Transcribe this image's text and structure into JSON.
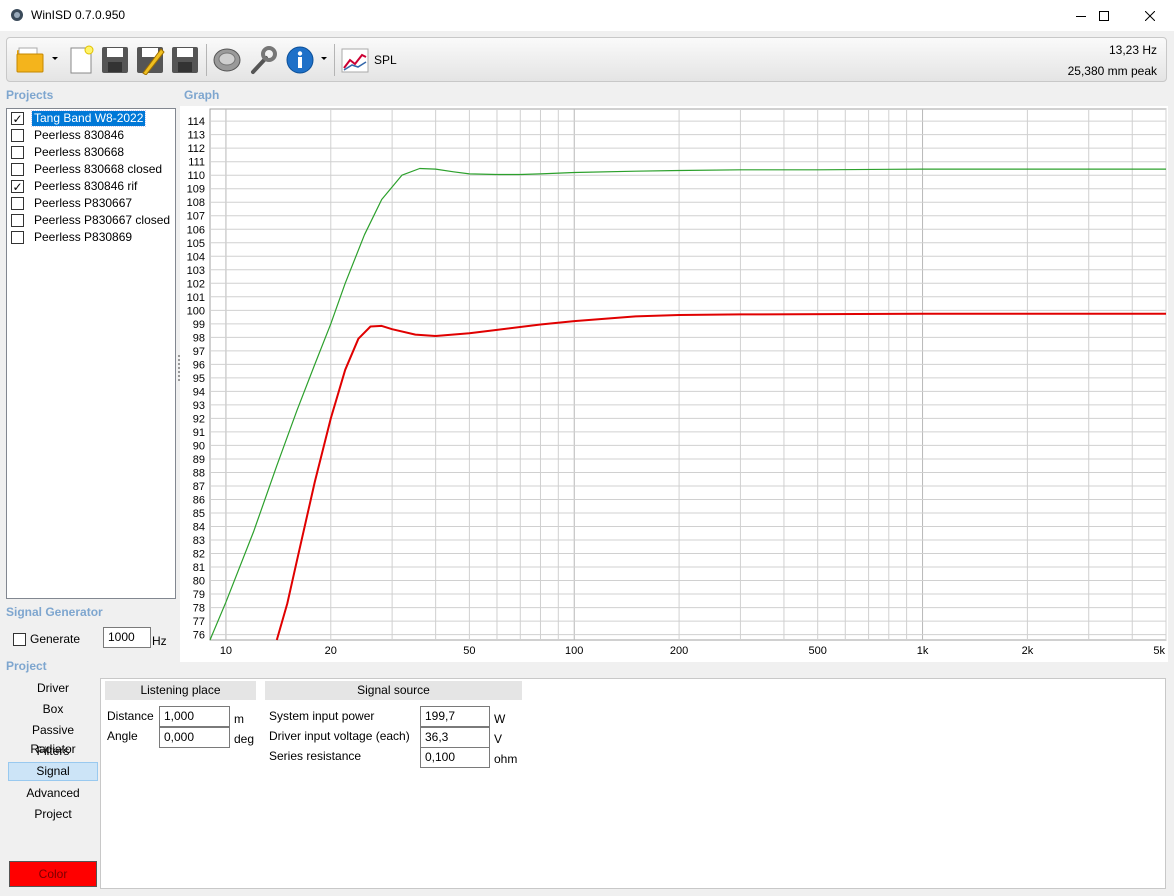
{
  "window": {
    "title": "WinISD 0.7.0.950"
  },
  "toolbar": {
    "spl_label": "SPL",
    "readout_freq": "13,23 Hz",
    "readout_excursion": "25,380 mm peak"
  },
  "sections": {
    "projects": "Projects",
    "graph": "Graph",
    "signal_generator": "Signal Generator",
    "project": "Project"
  },
  "projects": [
    {
      "label": "Tang Band W8-2022",
      "checked": "✓"
    },
    {
      "label": "Peerless 830846",
      "checked": ""
    },
    {
      "label": "Peerless 830668",
      "checked": ""
    },
    {
      "label": "Peerless 830668 closed",
      "checked": ""
    },
    {
      "label": "Peerless 830846 rif",
      "checked": "✓"
    },
    {
      "label": "Peerless P830667",
      "checked": ""
    },
    {
      "label": "Peerless P830667 closed",
      "checked": ""
    },
    {
      "label": "Peerless P830869",
      "checked": ""
    }
  ],
  "signal_generator": {
    "generate_label": "Generate",
    "frequency_value": "1000",
    "frequency_unit": "Hz"
  },
  "project_nav": [
    "Driver",
    "Box",
    "Passive Radiator",
    "Filters",
    "Signal",
    "Advanced",
    "Project"
  ],
  "color_button": {
    "label": "Color",
    "color": "#ff0000"
  },
  "listening_place": {
    "header": "Listening place",
    "distance_label": "Distance",
    "distance_value": "1,000",
    "distance_unit": "m",
    "angle_label": "Angle",
    "angle_value": "0,000",
    "angle_unit": "deg"
  },
  "signal_source": {
    "header": "Signal source",
    "power_label": "System input power",
    "power_value": "199,7",
    "power_unit": "W",
    "voltage_label": "Driver input voltage (each)",
    "voltage_value": "36,3",
    "voltage_unit": "V",
    "resistance_label": "Series resistance",
    "resistance_value": "0,100",
    "resistance_unit": "ohm"
  },
  "chart_data": {
    "type": "line",
    "x_scale": "log",
    "xlim": [
      9,
      5000
    ],
    "ylim": [
      75.6,
      114.9
    ],
    "xtick_labels": [
      {
        "v": 10,
        "t": "10"
      },
      {
        "v": 20,
        "t": "20"
      },
      {
        "v": 50,
        "t": "50"
      },
      {
        "v": 100,
        "t": "100"
      },
      {
        "v": 200,
        "t": "200"
      },
      {
        "v": 500,
        "t": "500"
      },
      {
        "v": 1000,
        "t": "1k"
      },
      {
        "v": 2000,
        "t": "2k"
      },
      {
        "v": 5000,
        "t": "5k"
      }
    ],
    "yticks": [
      76,
      77,
      78,
      79,
      80,
      81,
      82,
      83,
      84,
      85,
      86,
      87,
      88,
      89,
      90,
      91,
      92,
      93,
      94,
      95,
      96,
      97,
      98,
      99,
      100,
      101,
      102,
      103,
      104,
      105,
      106,
      107,
      108,
      109,
      110,
      111,
      112,
      113,
      114
    ],
    "grid": true,
    "series": [
      {
        "color": "#2ca02c",
        "points": [
          [
            9,
            75.6
          ],
          [
            10,
            78.4
          ],
          [
            12,
            83.6
          ],
          [
            14,
            88.5
          ],
          [
            16,
            92.6
          ],
          [
            18,
            96.0
          ],
          [
            20,
            99.0
          ],
          [
            22,
            102.0
          ],
          [
            25,
            105.6
          ],
          [
            28,
            108.2
          ],
          [
            32,
            110.0
          ],
          [
            36,
            110.5
          ],
          [
            40,
            110.45
          ],
          [
            45,
            110.25
          ],
          [
            50,
            110.1
          ],
          [
            60,
            110.05
          ],
          [
            70,
            110.05
          ],
          [
            80,
            110.1
          ],
          [
            100,
            110.2
          ],
          [
            150,
            110.3
          ],
          [
            200,
            110.35
          ],
          [
            300,
            110.4
          ],
          [
            500,
            110.4
          ],
          [
            1000,
            110.45
          ],
          [
            2000,
            110.45
          ],
          [
            5000,
            110.45
          ]
        ]
      },
      {
        "color": "#e00000",
        "points": [
          [
            14,
            75.6
          ],
          [
            15,
            78.3
          ],
          [
            16,
            81.5
          ],
          [
            18,
            87.3
          ],
          [
            20,
            92.0
          ],
          [
            22,
            95.6
          ],
          [
            24,
            97.9
          ],
          [
            26,
            98.8
          ],
          [
            28,
            98.85
          ],
          [
            30,
            98.6
          ],
          [
            35,
            98.2
          ],
          [
            40,
            98.1
          ],
          [
            50,
            98.3
          ],
          [
            60,
            98.55
          ],
          [
            80,
            98.95
          ],
          [
            100,
            99.2
          ],
          [
            150,
            99.55
          ],
          [
            200,
            99.65
          ],
          [
            300,
            99.7
          ],
          [
            1000,
            99.75
          ],
          [
            5000,
            99.75
          ]
        ]
      }
    ]
  }
}
